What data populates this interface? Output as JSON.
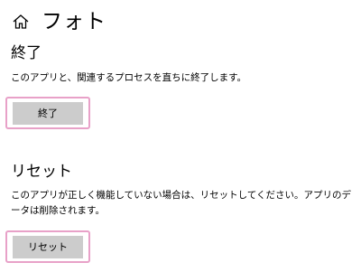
{
  "header": {
    "home_icon": "home-icon",
    "title": "フォト"
  },
  "terminate": {
    "title": "終了",
    "description": "このアプリと、関連するプロセスを直ちに終了します。",
    "button_label": "終了"
  },
  "reset": {
    "title": "リセット",
    "description": "このアプリが正しく機能していない場合は、リセットしてください。アプリのデータは削除されます。",
    "button_label": "リセット"
  },
  "colors": {
    "button_bg": "#cccccc",
    "highlight_border": "#e8a1c8",
    "text": "#000000",
    "background": "#ffffff"
  }
}
